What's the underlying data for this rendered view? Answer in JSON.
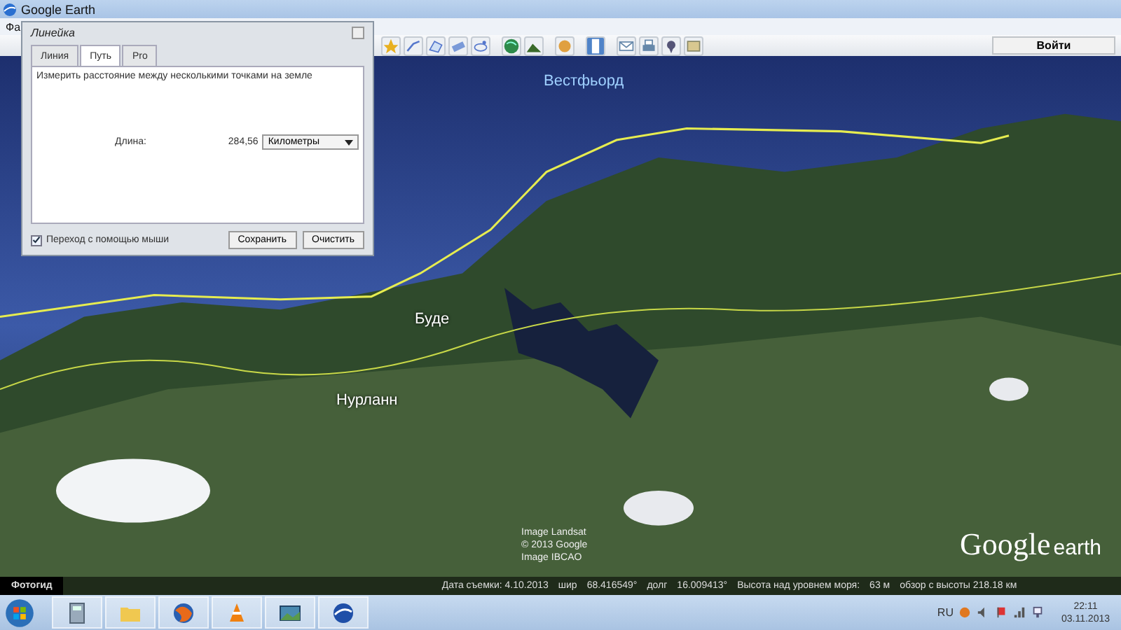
{
  "window": {
    "title": "Google Earth"
  },
  "menu": {
    "items": [
      "Фа"
    ]
  },
  "toolbar": {
    "signin": "Войти"
  },
  "dialog": {
    "title": "Линейка",
    "tabs": [
      {
        "label": "Линия",
        "selected": false
      },
      {
        "label": "Путь",
        "selected": true
      },
      {
        "label": "Pro",
        "selected": false
      }
    ],
    "description": "Измерить расстояние между несколькими точками на земле",
    "length_label": "Длина:",
    "length_value": "284,56",
    "unit": "Километры",
    "mouse_nav": {
      "label": "Переход с помощью мыши",
      "checked": true
    },
    "buttons": [
      "Сохранить",
      "Очистить"
    ]
  },
  "map": {
    "labels": [
      {
        "text": "Вестфьорд",
        "kind": "water"
      },
      {
        "text": "Буде",
        "kind": "town"
      },
      {
        "text": "Нурланн",
        "kind": "region"
      }
    ],
    "attribution": [
      "Image Landsat",
      "© 2013 Google",
      "Image IBCAO"
    ],
    "logo": {
      "word1": "Google",
      "word2": "earth"
    },
    "photo_guide": "Фотогид"
  },
  "status_bar": {
    "date": "Дата съемки: 4.10.2013",
    "lat_label": "шир",
    "lat": "68.416549°",
    "lon_label": "долг",
    "lon": "16.009413°",
    "elev_label": "Высота над уровнем моря:",
    "elev": "63 м",
    "eye": "обзор с высоты 218.18 км"
  },
  "taskbar": {
    "lang": "RU",
    "time": "22:11",
    "date": "03.11.2013"
  }
}
